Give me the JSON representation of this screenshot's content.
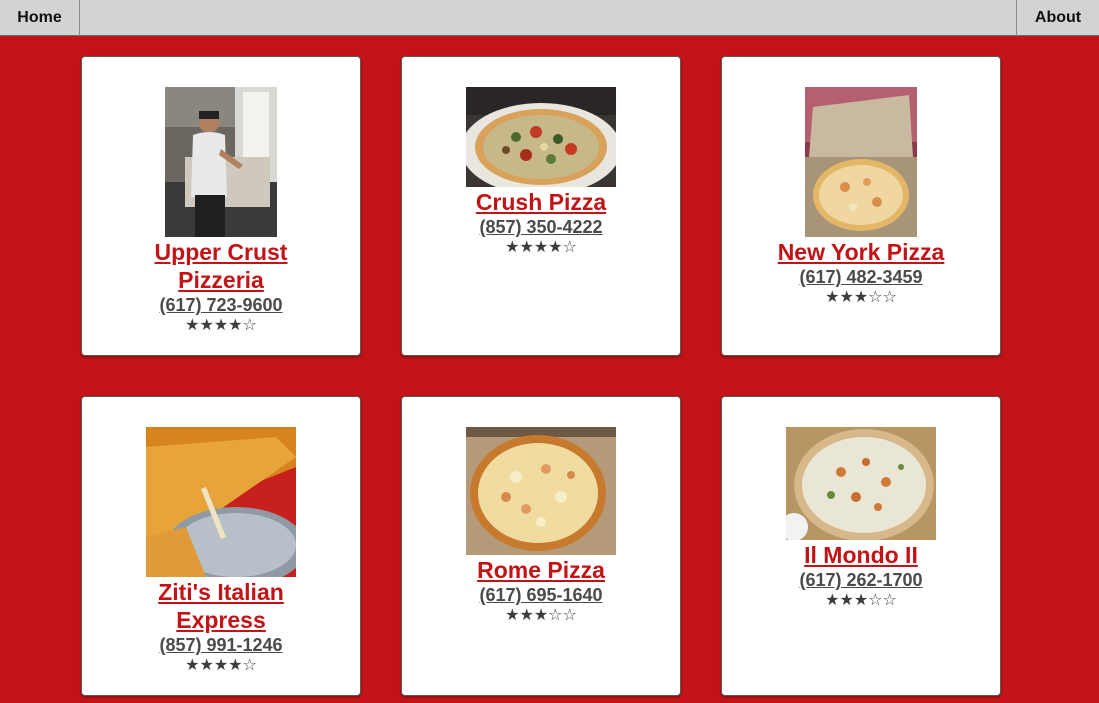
{
  "nav": {
    "home_label": "Home",
    "about_label": "About"
  },
  "restaurants": [
    {
      "name": "Upper Crust Pizzeria",
      "phone": "(617) 723-9600",
      "rating": 4,
      "rating_text": "★★★★☆",
      "photo": "pizza-maker-photo"
    },
    {
      "name": "Crush Pizza",
      "phone": "(857) 350-4222",
      "rating": 4,
      "rating_text": "★★★★☆",
      "photo": "vegetable-pizza-photo"
    },
    {
      "name": "New York Pizza",
      "phone": "(617) 482-3459",
      "rating": 3,
      "rating_text": "★★★☆☆",
      "photo": "boxed-pizza-photo"
    },
    {
      "name": "Ziti's Italian Express",
      "phone": "(857) 991-1246",
      "rating": 4,
      "rating_text": "★★★★☆",
      "photo": "cheese-slice-photo"
    },
    {
      "name": "Rome Pizza",
      "phone": "(617) 695-1640",
      "rating": 3,
      "rating_text": "★★★☆☆",
      "photo": "hawaiian-pizza-photo"
    },
    {
      "name": "Il Mondo II",
      "phone": "(617) 262-1700",
      "rating": 3,
      "rating_text": "★★★☆☆",
      "photo": "chicken-pizza-photo"
    }
  ],
  "colors": {
    "background": "#c21416",
    "name_link": "#c21416",
    "phone_link": "#4a4a4a",
    "topbar": "#d3d3d3"
  }
}
